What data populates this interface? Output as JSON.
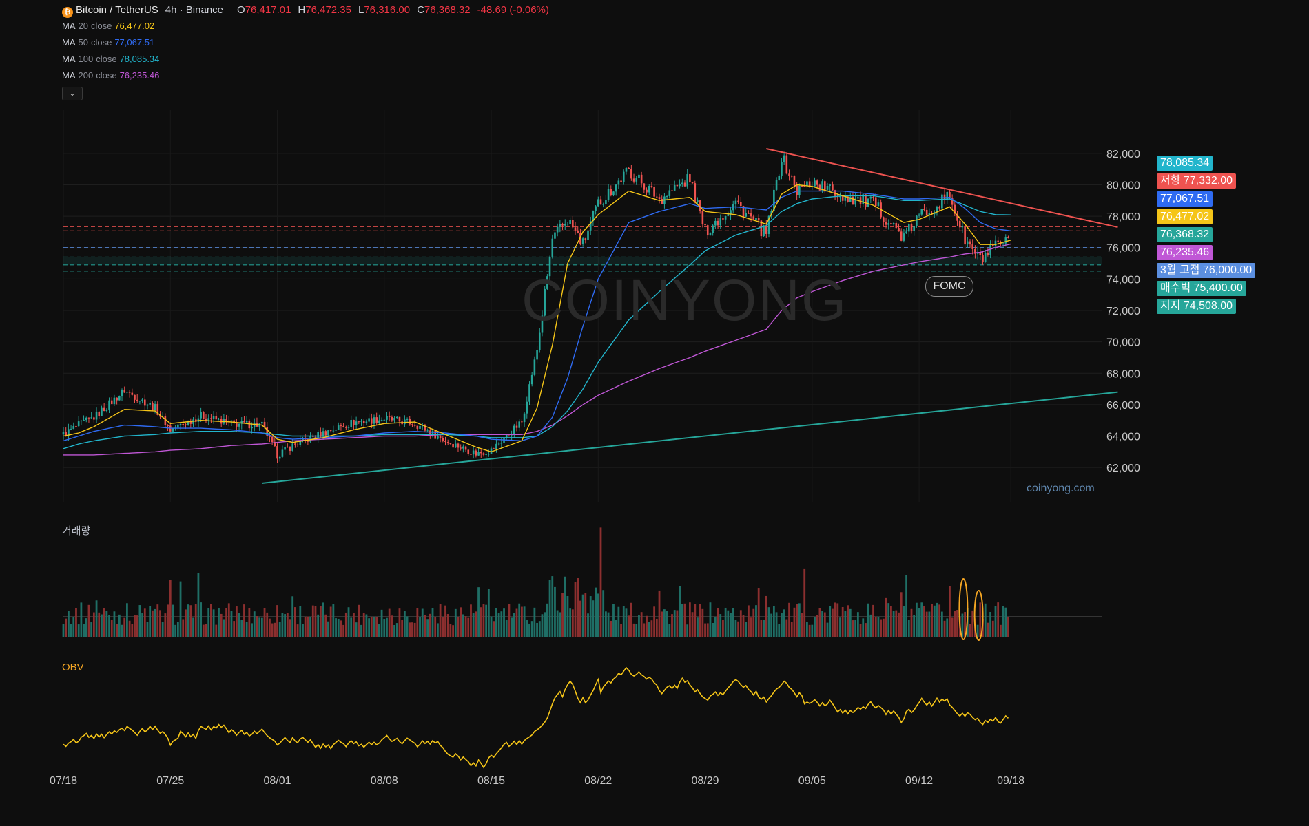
{
  "header": {
    "symbol": "Bitcoin / TetherUS",
    "interval": "4h · Binance",
    "open_label": "O",
    "open": "76,417.01",
    "high_label": "H",
    "high": "76,472.35",
    "low_label": "L",
    "low": "76,316.00",
    "close_label": "C",
    "close": "76,368.32",
    "change": "-48.69 (-0.06%)",
    "coin_glyph": "₿"
  },
  "indicators": [
    {
      "name": "MA",
      "period": "20",
      "src": "close",
      "value": "76,477.02",
      "color": "#f5c518"
    },
    {
      "name": "MA",
      "period": "50",
      "src": "close",
      "value": "77,067.51",
      "color": "#2f6bf2"
    },
    {
      "name": "MA",
      "period": "100",
      "src": "close",
      "value": "78,085.34",
      "color": "#22b5cc"
    },
    {
      "name": "MA",
      "period": "200",
      "src": "close",
      "value": "76,235.46",
      "color": "#c057d6"
    }
  ],
  "collapse_icon": "chevron-down-icon",
  "panes": {
    "volume": "거래량",
    "obv": "OBV"
  },
  "watermark": "COINYONG",
  "site": "coinyong.com",
  "annotation": "FOMC",
  "price_tags": [
    {
      "text": "78,085.34",
      "color": "#22b5cc",
      "price": 78085.34
    },
    {
      "text": "저항 77,332.00",
      "color": "#ef5350",
      "price": 77332
    },
    {
      "text": "77,067.51",
      "color": "#2f6bf2",
      "price": 77067.51
    },
    {
      "text": "76,477.02",
      "color": "#f5c518",
      "price": 76477.02
    },
    {
      "text": "76,368.32",
      "color": "#26a69a",
      "price": 76368.32
    },
    {
      "text": "76,235.46",
      "color": "#c057d6",
      "price": 76235.46
    },
    {
      "text": "3월 고점 76,000.00",
      "color": "#5b8fe0",
      "price": 76000
    },
    {
      "text": "매수벽 75,400.00",
      "color": "#26a69a",
      "price": 75400
    },
    {
      "text": "지지 74,508.00",
      "color": "#26a69a",
      "price": 74508
    }
  ],
  "chart_data": {
    "type": "line",
    "description_series": "4h candlestick OHLC with moving averages, volume and OBV",
    "xlim": [
      "07/18",
      "09/18"
    ],
    "ylim": [
      61000,
      83000
    ],
    "y_ticks": [
      "82,000",
      "80,000",
      "78,000",
      "76,000",
      "74,000",
      "72,000",
      "70,000",
      "68,000",
      "66,000",
      "64,000",
      "62,000"
    ],
    "y_tick_values": [
      82000,
      80000,
      78000,
      76000,
      74000,
      72000,
      70000,
      68000,
      66000,
      64000,
      62000
    ],
    "x_ticks": [
      "07/18",
      "07/25",
      "08/01",
      "08/08",
      "08/15",
      "08/22",
      "08/29",
      "09/05",
      "09/12",
      "09/18"
    ],
    "price_anchors": {
      "x": [
        "07/18",
        "07/19",
        "07/20",
        "07/22",
        "07/24",
        "07/25",
        "07/27",
        "07/29",
        "07/31",
        "08/01",
        "08/02",
        "08/04",
        "08/06",
        "08/08",
        "08/10",
        "08/12",
        "08/14",
        "08/15",
        "08/17",
        "08/18",
        "08/19",
        "08/20",
        "08/21",
        "08/22",
        "08/24",
        "08/26",
        "08/28",
        "08/29",
        "08/31",
        "09/02",
        "09/03",
        "09/04",
        "09/05",
        "09/07",
        "09/09",
        "09/11",
        "09/12",
        "09/14",
        "09/15",
        "09/16",
        "09/17",
        "09/18"
      ],
      "close": [
        64100,
        64700,
        65200,
        66900,
        65800,
        64400,
        65300,
        64800,
        64700,
        62800,
        63400,
        64200,
        64900,
        65100,
        64800,
        63700,
        62900,
        63100,
        64900,
        69500,
        76500,
        77800,
        76200,
        78800,
        80900,
        79100,
        80400,
        77000,
        78900,
        76800,
        81800,
        79600,
        80200,
        79300,
        78800,
        76600,
        78000,
        79300,
        76500,
        75200,
        76000,
        76368
      ]
    },
    "ma20_anchors": [
      64000,
      64200,
      64600,
      65700,
      65600,
      64800,
      65000,
      64900,
      64700,
      63800,
      63600,
      63900,
      64400,
      64800,
      64900,
      64100,
      63300,
      63000,
      63700,
      65800,
      69800,
      75000,
      77000,
      78100,
      79600,
      79000,
      79200,
      78300,
      78100,
      77500,
      79400,
      80000,
      79900,
      79300,
      78700,
      77600,
      77800,
      78600,
      77500,
      76200,
      76200,
      76477
    ],
    "ma50_anchors": [
      63700,
      64000,
      64300,
      64700,
      64600,
      64500,
      64500,
      64400,
      64200,
      63900,
      63800,
      63900,
      64000,
      64200,
      64300,
      64200,
      64000,
      63800,
      63700,
      64000,
      65200,
      67700,
      71000,
      74000,
      77600,
      78300,
      78800,
      78500,
      78600,
      78400,
      79200,
      79600,
      79600,
      79600,
      79400,
      79100,
      79100,
      79200,
      78500,
      77600,
      77200,
      77067
    ],
    "ma100_anchors": [
      63200,
      63500,
      63700,
      64000,
      64100,
      64200,
      64300,
      64300,
      64200,
      64100,
      64000,
      64000,
      64000,
      64100,
      64100,
      64100,
      64000,
      63900,
      63900,
      64000,
      64600,
      65600,
      67000,
      68700,
      71400,
      73200,
      74900,
      75800,
      76800,
      77400,
      78300,
      78800,
      79100,
      79300,
      79300,
      79000,
      79000,
      79100,
      78700,
      78300,
      78100,
      78085
    ],
    "ma200_anchors": [
      62800,
      62800,
      62800,
      62900,
      63000,
      63100,
      63200,
      63400,
      63500,
      63600,
      63700,
      63800,
      63900,
      64000,
      64000,
      64100,
      64100,
      64100,
      64100,
      64300,
      64700,
      65300,
      66000,
      66600,
      67500,
      68300,
      69000,
      69400,
      70100,
      70800,
      72000,
      72800,
      73200,
      73900,
      74500,
      74900,
      75100,
      75400,
      75600,
      75700,
      76000,
      76235
    ],
    "resistance_trendline": {
      "from": [
        "09/02",
        82300
      ],
      "to": [
        "09/25",
        77300
      ]
    },
    "support_trendline": {
      "from": [
        "07/31",
        61000
      ],
      "to": [
        "09/25",
        66800
      ]
    },
    "horizontal_levels": [
      77332,
      77067.51,
      76000,
      75400,
      74900,
      74508
    ],
    "volume": {
      "title": "거래량"
    },
    "obv": {
      "title": "OBV"
    },
    "grid": true
  }
}
